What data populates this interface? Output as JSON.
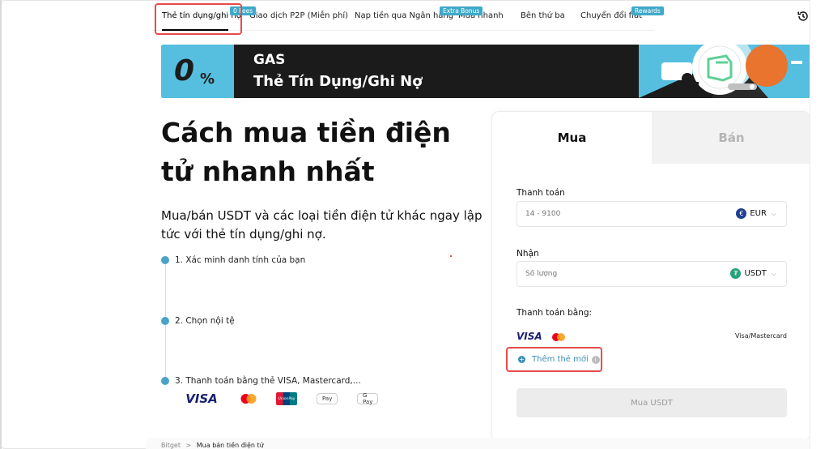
{
  "tabs": [
    {
      "label": "Thẻ tín dụng/ghi nợ",
      "badge": "0 Fees"
    },
    {
      "label": "Giao dịch P2P (Miễn phí)",
      "badge": ""
    },
    {
      "label": "Nạp tiền qua Ngân hàng",
      "badge": "Extra Bonus"
    },
    {
      "label": "Mua nhanh",
      "badge": ""
    },
    {
      "label": "Bên thứ ba",
      "badge": ""
    },
    {
      "label": "Chuyển đổi fiat",
      "badge": "Rewards"
    }
  ],
  "banner": {
    "zero": "0",
    "percent": "%",
    "title": "GAS",
    "subtitle": "Thẻ Tín Dụng/Ghi Nợ"
  },
  "hero": {
    "title": "Cách mua tiền điện tử nhanh nhất",
    "description": "Mua/bán USDT và các loại tiền điện tử khác ngay lập tức với thẻ tín dụng/ghi nợ."
  },
  "steps": [
    "1. Xác minh danh tính của bạn",
    "2. Chọn nội tệ",
    "3. Thanh toán bằng thẻ VISA, Mastercard,..."
  ],
  "payment_logos": {
    "visa": "VISA",
    "unionpay": "UnionPay",
    "apple_pay": " Pay",
    "google_pay": "G Pay"
  },
  "panel": {
    "tab_buy": "Mua",
    "tab_sell": "Bán",
    "pay_label": "Thanh toán",
    "pay_placeholder": "14 - 9100",
    "pay_currency": "EUR",
    "receive_label": "Nhận",
    "receive_placeholder": "Số lượng",
    "receive_currency": "USDT",
    "pay_with_label": "Thanh toán bằng:",
    "visa_mini": "VISA",
    "pay_method": "Visa/Mastercard",
    "add_card": "Thêm thẻ mới",
    "buy_button": "Mua USDT"
  },
  "breadcrumb": {
    "home": "Bitget",
    "separator": ">",
    "current": "Mua bán tiền điện tử"
  },
  "colors": {
    "accent": "#3fa9c9",
    "highlight": "#e54b4b",
    "banner_dark": "#1b1b1b",
    "banner_blue": "#56bfdf"
  }
}
